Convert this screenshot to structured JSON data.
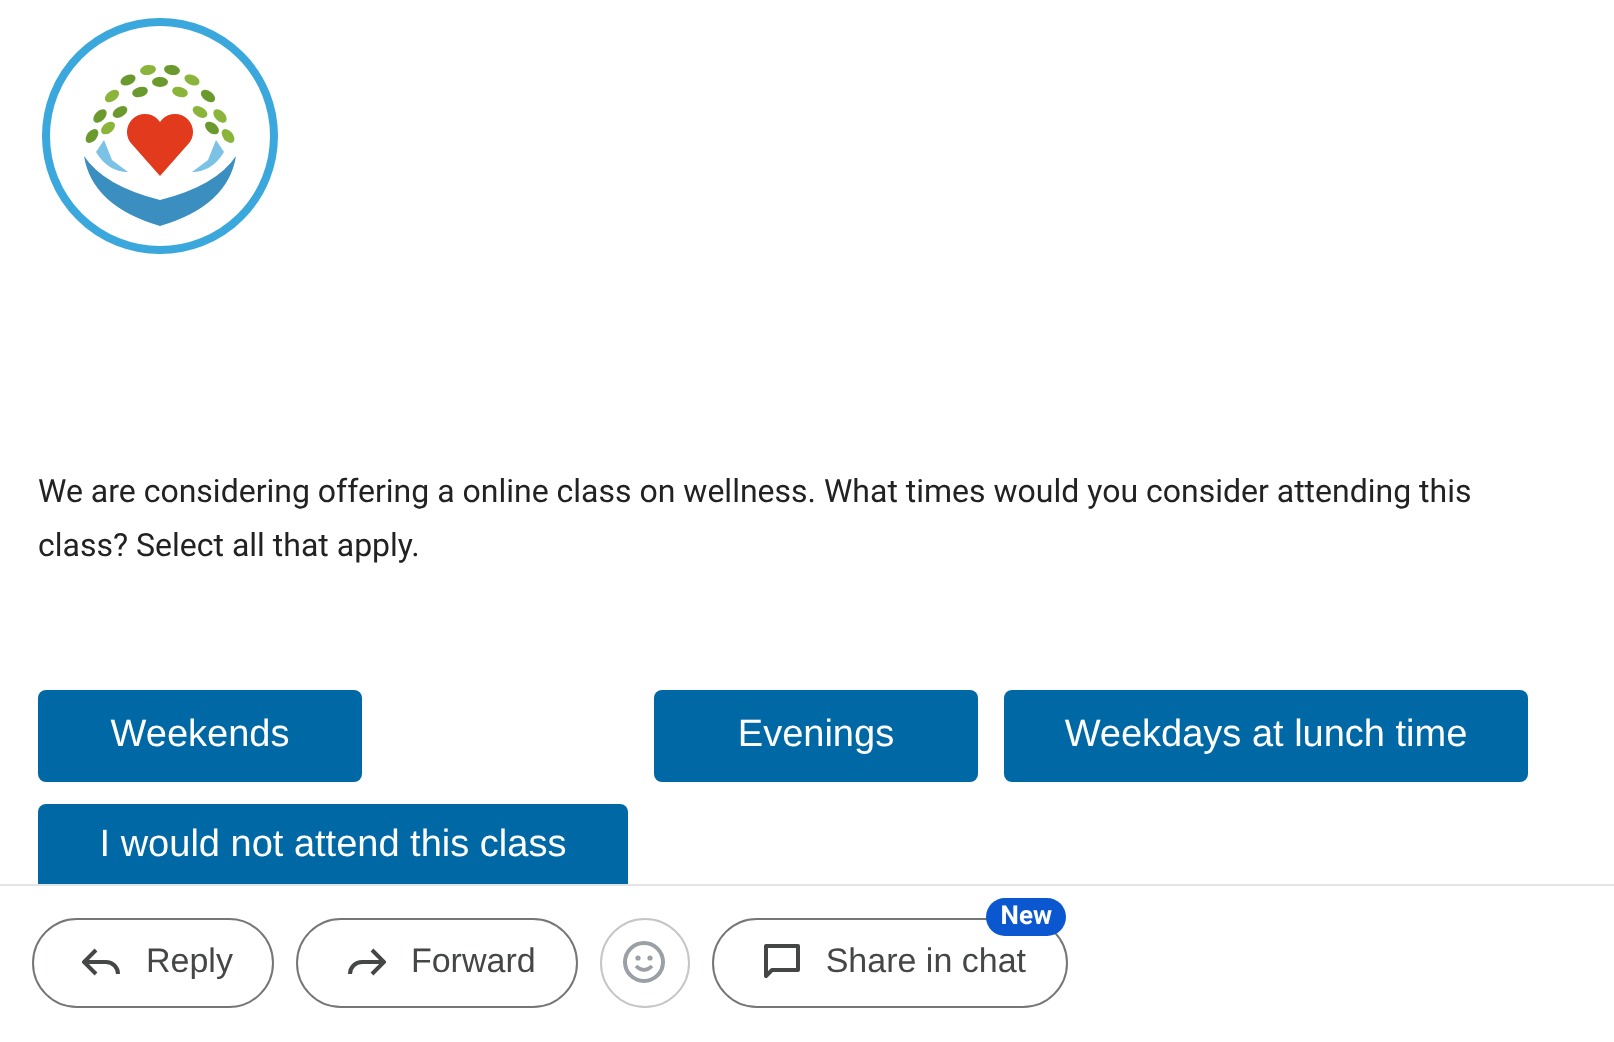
{
  "message": {
    "text": "We are considering offering a online class on wellness. What times would you consider attending this class? Select all that apply."
  },
  "options": [
    {
      "label": "Weekends"
    },
    {
      "label": "Evenings"
    },
    {
      "label": "Weekdays at lunch time"
    },
    {
      "label": "I would not attend this class"
    }
  ],
  "actions": [
    {
      "kind": "reply",
      "label": "Reply"
    },
    {
      "kind": "forward",
      "label": "Forward"
    },
    {
      "kind": "emoji"
    },
    {
      "kind": "chat",
      "label": "Share in chat",
      "badge": "New"
    }
  ]
}
